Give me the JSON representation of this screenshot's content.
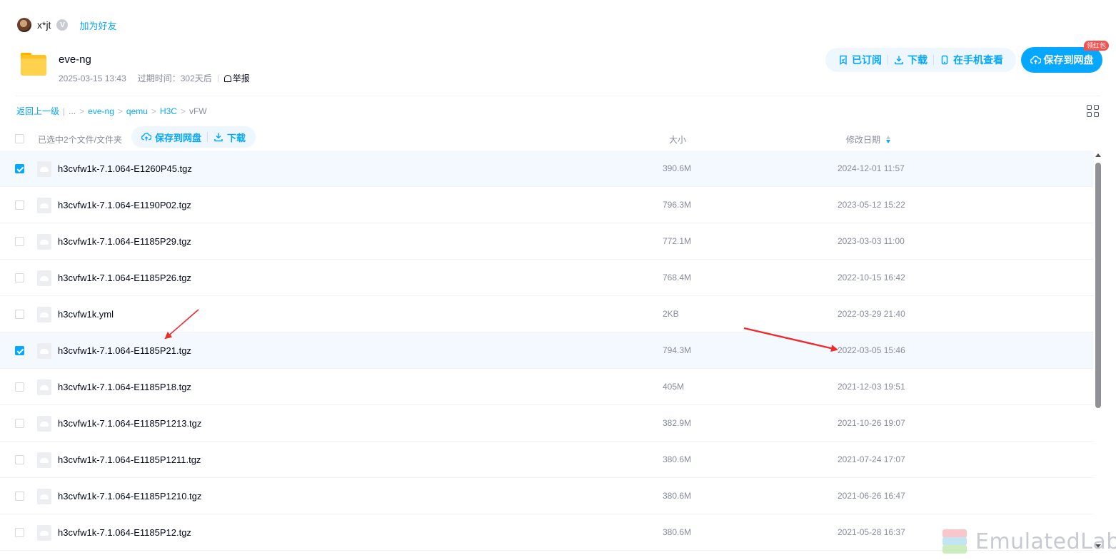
{
  "user": {
    "name": "x*jt",
    "vip_badge": "V",
    "add_friend": "加为好友"
  },
  "share": {
    "title": "eve-ng",
    "created": "2025-03-15 13:43",
    "expire": "过期时间：302天后",
    "report": "举报"
  },
  "actions": {
    "subscribed": "已订阅",
    "download": "下载",
    "view_on_phone": "在手机查看",
    "save_to_drive": "保存到网盘",
    "red_packet_badge": "领红包"
  },
  "breadcrumb": {
    "back": "返回上一级",
    "ellipsis": "...",
    "items": [
      "eve-ng",
      "qemu",
      "H3C"
    ],
    "current": "vFW",
    "separator": ">"
  },
  "list_header": {
    "selected_text": "已选中2个文件/文件夹",
    "save_to_drive": "保存到网盘",
    "download": "下载",
    "col_size": "大小",
    "col_date": "修改日期"
  },
  "files": [
    {
      "name": "h3cvfw1k-7.1.064-E1260P45.tgz",
      "size": "390.6M",
      "date": "2024-12-01 11:57",
      "selected": true
    },
    {
      "name": "h3cvfw1k-7.1.064-E1190P02.tgz",
      "size": "796.3M",
      "date": "2023-05-12 15:22",
      "selected": false
    },
    {
      "name": "h3cvfw1k-7.1.064-E1185P29.tgz",
      "size": "772.1M",
      "date": "2023-03-03 11:00",
      "selected": false
    },
    {
      "name": "h3cvfw1k-7.1.064-E1185P26.tgz",
      "size": "768.4M",
      "date": "2022-10-15 16:42",
      "selected": false
    },
    {
      "name": "h3cvfw1k.yml",
      "size": "2KB",
      "date": "2022-03-29 21:40",
      "selected": false
    },
    {
      "name": "h3cvfw1k-7.1.064-E1185P21.tgz",
      "size": "794.3M",
      "date": "2022-03-05 15:46",
      "selected": true
    },
    {
      "name": "h3cvfw1k-7.1.064-E1185P18.tgz",
      "size": "405M",
      "date": "2021-12-03 19:51",
      "selected": false
    },
    {
      "name": "h3cvfw1k-7.1.064-E1185P1213.tgz",
      "size": "382.9M",
      "date": "2021-10-26 19:07",
      "selected": false
    },
    {
      "name": "h3cvfw1k-7.1.064-E1185P1211.tgz",
      "size": "380.6M",
      "date": "2021-07-24 17:07",
      "selected": false
    },
    {
      "name": "h3cvfw1k-7.1.064-E1185P1210.tgz",
      "size": "380.6M",
      "date": "2021-06-26 16:47",
      "selected": false
    },
    {
      "name": "h3cvfw1k-7.1.064-E1185P12.tgz",
      "size": "380.6M",
      "date": "2021-05-28 16:37",
      "selected": false
    }
  ],
  "watermark": {
    "text": "EmulatedLab"
  },
  "colors": {
    "accent": "#06a7ff",
    "selected_row": "#f4f9ff",
    "annotation_arrow": "#ee2a2a",
    "badge": "#f55150"
  }
}
